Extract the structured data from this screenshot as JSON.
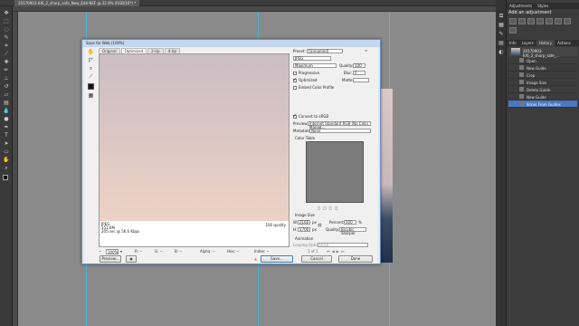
{
  "document": {
    "tab_title": "20170903-IU6_2_sharp_safe_New_Edit.NEF @ 32.9% (RGB/16*) *"
  },
  "tools": [
    "move-icon",
    "marquee-icon",
    "lasso-icon",
    "quick-select-icon",
    "crop-icon",
    "eyedropper-icon",
    "healing-icon",
    "brush-icon",
    "clone-stamp-icon",
    "history-brush-icon",
    "eraser-icon",
    "gradient-icon",
    "blur-icon",
    "dodge-icon",
    "pen-icon",
    "type-icon",
    "path-select-icon",
    "shape-icon",
    "hand-icon",
    "zoom-icon"
  ],
  "panels": {
    "adjustments_tabs": [
      "Adjustments",
      "Styles"
    ],
    "adjustments_title": "Add an adjustment",
    "history_tabs": [
      "Info",
      "Layers",
      "History",
      "Actions"
    ],
    "snapshot_label": "20170903-IU6_2_sharp_safe_...",
    "history_items": [
      "Open",
      "New Guide",
      "Crop",
      "Image Size",
      "Delete Guide",
      "New Guide",
      "Slices From Guides"
    ]
  },
  "dialog": {
    "title": "Save for Web (100%)",
    "view_tabs": [
      "Original",
      "Optimized",
      "2-Up",
      "4-Up"
    ],
    "preview_info": [
      "JPEG",
      "151.6M",
      "205 sec @ 56.6 Kbps"
    ],
    "preview_quality": "100 quality",
    "zoom": "100%",
    "bottom_readouts": [
      "R: --",
      "G: --",
      "B: --",
      "Alpha: --",
      "Hex: --",
      "Index: --"
    ],
    "preset_label": "Preset:",
    "preset_value": "[Unnamed]",
    "format_value": "JPEG",
    "compression_value": "Maximum",
    "quality_label": "Quality:",
    "quality_value": "100",
    "progressive_label": "Progressive",
    "blur_label": "Blur:",
    "blur_value": "0",
    "optimized_label": "Optimized",
    "matte_label": "Matte:",
    "embed_label": "Embed Color Profile",
    "convert_label": "Convert to sRGB",
    "preview_label": "Preview:",
    "preview_value": "Internet Standard RGB (No Color Manag...",
    "metadata_label": "Metadata:",
    "metadata_value": "None",
    "color_table_label": "Color Table",
    "image_size_label": "Image Size",
    "width_label": "W:",
    "width_value": "2160",
    "height_label": "H:",
    "height_value": "1700",
    "units": "px",
    "percent_label": "Percent:",
    "percent_value": "100",
    "percent_unit": "%",
    "resample_label": "Quality:",
    "resample_value": "Bicubic Sharper",
    "animation_label": "Animation",
    "looping_label": "Looping Options:",
    "looping_value": "Once",
    "frame_counter": "1 of 1",
    "buttons": {
      "preview": "Preview...",
      "save": "Save...",
      "cancel": "Cancel",
      "done": "Done"
    }
  }
}
